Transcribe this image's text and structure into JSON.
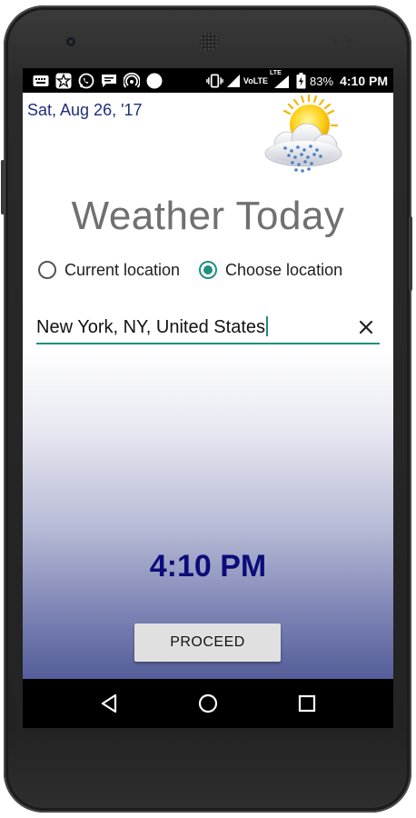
{
  "status_bar": {
    "battery_percent": "83%",
    "time": "4:10 PM",
    "network_label": "VoLTE",
    "lte_label": "LTE",
    "icons": [
      "keyboard-icon",
      "star-icon",
      "whatsapp-icon",
      "message-icon",
      "hotspot-icon",
      "circle-icon",
      "vibrate-icon",
      "volte-icon",
      "signal-icon",
      "battery-icon"
    ]
  },
  "app": {
    "date": "Sat, Aug 26, '17",
    "weather_icon": "sun-cloud-snow-icon",
    "title": "Weather Today",
    "location_mode": {
      "options": [
        "Current location",
        "Choose location"
      ],
      "selected": "Choose location"
    },
    "location_input": {
      "value": "New York, NY, United States"
    },
    "clock": "4:10 PM",
    "proceed_label": "PROCEED"
  },
  "colors": {
    "accent": "#1f8f80",
    "date_text": "#1f2f7a",
    "clock_text": "#0d0d7a",
    "title_text": "#707070",
    "gradient_bottom": "#555d99"
  },
  "nav_bar": {
    "buttons": [
      "back-icon",
      "home-icon",
      "recents-icon"
    ]
  }
}
